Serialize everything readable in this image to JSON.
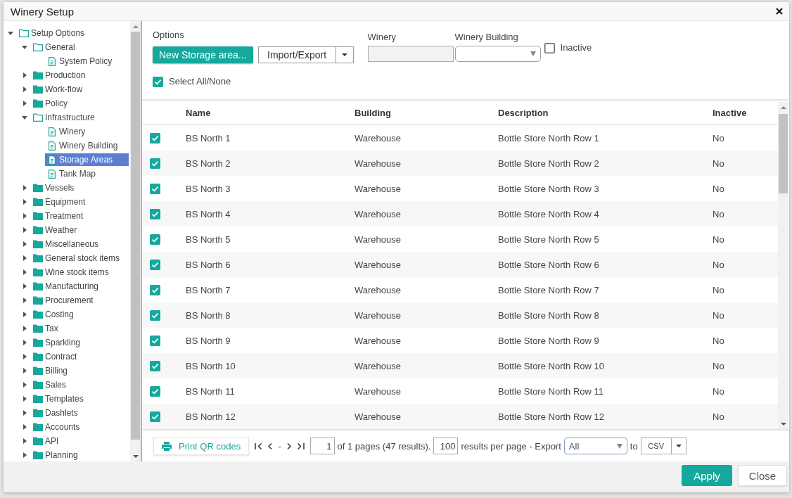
{
  "window": {
    "title": "Winery Setup"
  },
  "tree": {
    "items": [
      {
        "kind": "folder",
        "label": "Setup Options",
        "expanded": true,
        "selected": false,
        "children": [
          {
            "kind": "folder",
            "label": "General",
            "expanded": true,
            "selected": false,
            "children": [
              {
                "kind": "page",
                "label": "System Policy",
                "selected": false
              }
            ]
          },
          {
            "kind": "folder",
            "label": "Production",
            "expanded": false,
            "selected": false
          },
          {
            "kind": "folder",
            "label": "Work-flow",
            "expanded": false,
            "selected": false
          },
          {
            "kind": "folder",
            "label": "Policy",
            "expanded": false,
            "selected": false
          },
          {
            "kind": "folder",
            "label": "Infrastructure",
            "expanded": true,
            "selected": false,
            "children": [
              {
                "kind": "page",
                "label": "Winery",
                "selected": false
              },
              {
                "kind": "page",
                "label": "Winery Building",
                "selected": false
              },
              {
                "kind": "page",
                "label": "Storage Areas",
                "selected": true
              },
              {
                "kind": "page",
                "label": "Tank Map",
                "selected": false
              }
            ]
          },
          {
            "kind": "folder",
            "label": "Vessels",
            "expanded": false,
            "selected": false
          },
          {
            "kind": "folder",
            "label": "Equipment",
            "expanded": false,
            "selected": false
          },
          {
            "kind": "folder",
            "label": "Treatment",
            "expanded": false,
            "selected": false
          },
          {
            "kind": "folder",
            "label": "Weather",
            "expanded": false,
            "selected": false
          },
          {
            "kind": "folder",
            "label": "Miscellaneous",
            "expanded": false,
            "selected": false
          },
          {
            "kind": "folder",
            "label": "General stock items",
            "expanded": false,
            "selected": false
          },
          {
            "kind": "folder",
            "label": "Wine stock items",
            "expanded": false,
            "selected": false
          },
          {
            "kind": "folder",
            "label": "Manufacturing",
            "expanded": false,
            "selected": false
          },
          {
            "kind": "folder",
            "label": "Procurement",
            "expanded": false,
            "selected": false
          },
          {
            "kind": "folder",
            "label": "Costing",
            "expanded": false,
            "selected": false
          },
          {
            "kind": "folder",
            "label": "Tax",
            "expanded": false,
            "selected": false
          },
          {
            "kind": "folder",
            "label": "Sparkling",
            "expanded": false,
            "selected": false
          },
          {
            "kind": "folder",
            "label": "Contract",
            "expanded": false,
            "selected": false
          },
          {
            "kind": "folder",
            "label": "Billing",
            "expanded": false,
            "selected": false
          },
          {
            "kind": "folder",
            "label": "Sales",
            "expanded": false,
            "selected": false
          },
          {
            "kind": "folder",
            "label": "Templates",
            "expanded": false,
            "selected": false
          },
          {
            "kind": "folder",
            "label": "Dashlets",
            "expanded": false,
            "selected": false
          },
          {
            "kind": "folder",
            "label": "Accounts",
            "expanded": false,
            "selected": false
          },
          {
            "kind": "folder",
            "label": "API",
            "expanded": false,
            "selected": false
          },
          {
            "kind": "folder",
            "label": "Planning",
            "expanded": false,
            "selected": false
          }
        ]
      }
    ]
  },
  "options": {
    "label": "Options",
    "new_button": "New Storage area...",
    "import_export": "Import/Export",
    "winery": {
      "label": "Winery",
      "disabled": true
    },
    "winery_building": {
      "label": "Winery Building"
    },
    "inactive": {
      "label": "Inactive",
      "checked": false
    },
    "select_all": {
      "label": "Select All/None",
      "checked": true
    }
  },
  "table": {
    "columns": [
      "Name",
      "Building",
      "Description",
      "Inactive"
    ],
    "rows": [
      {
        "checked": true,
        "name": "BS North 1",
        "building": "Warehouse",
        "description": "Bottle Store North Row 1",
        "inactive": "No"
      },
      {
        "checked": true,
        "name": "BS North 2",
        "building": "Warehouse",
        "description": "Bottle Store North Row 2",
        "inactive": "No"
      },
      {
        "checked": true,
        "name": "BS North 3",
        "building": "Warehouse",
        "description": "Bottle Store North Row 3",
        "inactive": "No"
      },
      {
        "checked": true,
        "name": "BS North 4",
        "building": "Warehouse",
        "description": "Bottle Store North Row 4",
        "inactive": "No"
      },
      {
        "checked": true,
        "name": "BS North 5",
        "building": "Warehouse",
        "description": "Bottle Store North Row 5",
        "inactive": "No"
      },
      {
        "checked": true,
        "name": "BS North 6",
        "building": "Warehouse",
        "description": "Bottle Store North Row 6",
        "inactive": "No"
      },
      {
        "checked": true,
        "name": "BS North 7",
        "building": "Warehouse",
        "description": "Bottle Store North Row 7",
        "inactive": "No"
      },
      {
        "checked": true,
        "name": "BS North 8",
        "building": "Warehouse",
        "description": "Bottle Store North Row 8",
        "inactive": "No"
      },
      {
        "checked": true,
        "name": "BS North 9",
        "building": "Warehouse",
        "description": "Bottle Store North Row 9",
        "inactive": "No"
      },
      {
        "checked": true,
        "name": "BS North 10",
        "building": "Warehouse",
        "description": "Bottle Store North Row 10",
        "inactive": "No"
      },
      {
        "checked": true,
        "name": "BS North 11",
        "building": "Warehouse",
        "description": "Bottle Store North Row 11",
        "inactive": "No"
      },
      {
        "checked": true,
        "name": "BS North 12",
        "building": "Warehouse",
        "description": "Bottle Store North Row 12",
        "inactive": "No"
      }
    ]
  },
  "pager": {
    "print_button": "Print QR codes",
    "page_range": "-",
    "page": "1",
    "page_info": "of 1 pages (47 results).",
    "per_page": "100",
    "per_page_label": "results per page - Export",
    "export_scope": "All",
    "to_label": "to",
    "format": "CSV"
  },
  "buttons": [
    {
      "label": "Apply",
      "kind": "primary"
    },
    {
      "label": "Close",
      "kind": "secondary"
    }
  ]
}
